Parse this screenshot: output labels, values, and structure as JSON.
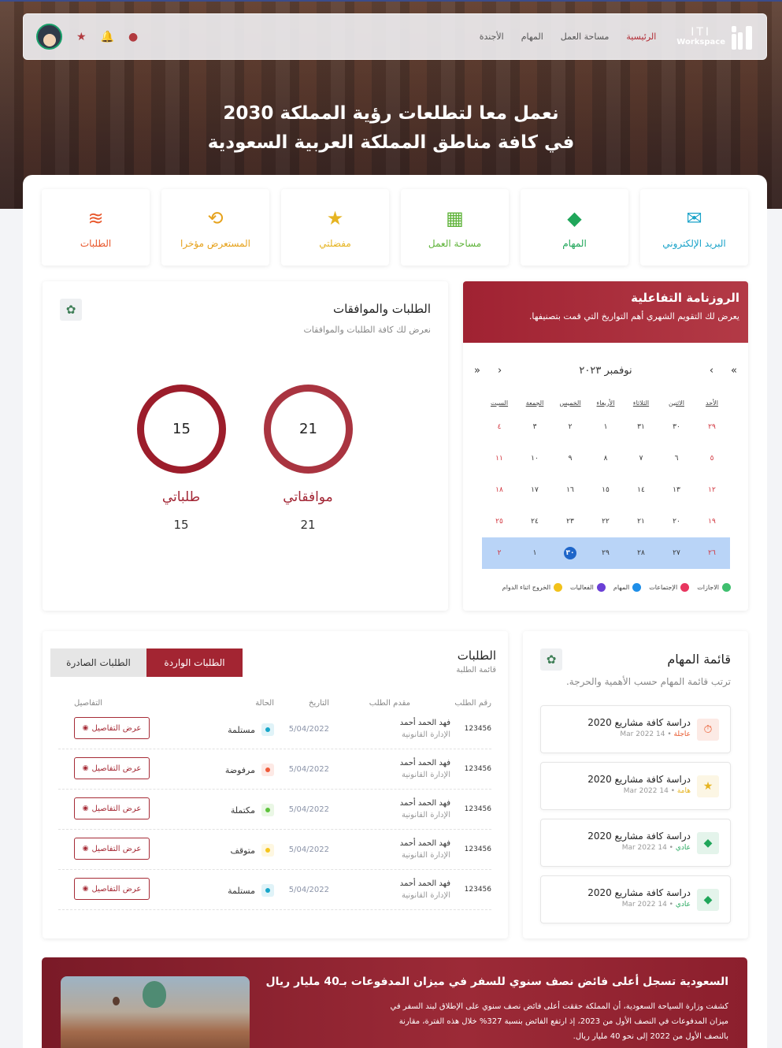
{
  "nav": {
    "brand_top": "ITI",
    "brand_bottom": "Workspace",
    "links": [
      "الرئيسية",
      "مساحة العمل",
      "المهام",
      "الأجندة"
    ]
  },
  "hero": {
    "line1": "نعمل معا لتطلعات رؤية المملكة 2030",
    "line2": "في كافة مناطق المملكة العربية السعودية"
  },
  "quick_links": [
    {
      "label": "البريد الإلكتروني",
      "icon": "mail-icon",
      "color": "#1aa3c9"
    },
    {
      "label": "المهام",
      "icon": "tasks-icon",
      "color": "#20a65a"
    },
    {
      "label": "مساحة العمل",
      "icon": "grid-icon",
      "color": "#5fb33a"
    },
    {
      "label": "مفضلتي",
      "icon": "star-icon",
      "color": "#e6b422"
    },
    {
      "label": "المستعرض مؤخرا",
      "icon": "history-icon",
      "color": "#e6a21c"
    },
    {
      "label": "الطلبات",
      "icon": "layers-icon",
      "color": "#e8562a"
    }
  ],
  "calendar": {
    "title": "الروزنامة التفاعلية",
    "subtitle": "يعرض لك التقويم الشهري أهم التواريخ التي قمت بتصنيفها.",
    "month": "نوفمبر ٢٠٢٣",
    "weekdays": [
      "الأحد",
      "الاثنين",
      "الثلاثاء",
      "الأربعاء",
      "الخميس",
      "الجمعة",
      "السبت"
    ],
    "weeks": [
      [
        "٢٩",
        "٣٠",
        "٣١",
        "١",
        "٢",
        "٣",
        "٤"
      ],
      [
        "٥",
        "٦",
        "٧",
        "٨",
        "٩",
        "١٠",
        "١١"
      ],
      [
        "١٢",
        "١٣",
        "١٤",
        "١٥",
        "١٦",
        "١٧",
        "١٨"
      ],
      [
        "١٩",
        "٢٠",
        "٢١",
        "٢٢",
        "٢٣",
        "٢٤",
        "٢٥"
      ],
      [
        "٢٦",
        "٢٧",
        "٢٨",
        "٢٩",
        "٣٠",
        "١",
        "٢"
      ]
    ],
    "today": "٣٠",
    "legend": [
      {
        "label": "الاجازات",
        "color": "#3fbf6f"
      },
      {
        "label": "الإجتماعات",
        "color": "#e8365f"
      },
      {
        "label": "المهام",
        "color": "#1e8ee8"
      },
      {
        "label": "الفعاليات",
        "color": "#6a3fd6"
      },
      {
        "label": "الخروج اثناء الدوام",
        "color": "#f2c21b"
      }
    ]
  },
  "approvals": {
    "title": "الطلبات والموافقات",
    "subtitle": "نعرض لك كافة الطلبات والموافقات",
    "approvals_value": "21",
    "approvals_label": "موافقاتي",
    "requests_value": "15",
    "requests_label": "طلباتي"
  },
  "requests": {
    "title": "الطلبات",
    "subtitle": "قائمة الطلبة",
    "tab_incoming": "الطلبات الواردة",
    "tab_outgoing": "الطلبات الصادرة",
    "columns": [
      "رقم الطلب",
      "مقدم الطلب",
      "التاريخ",
      "الحالة",
      "التفاصيل"
    ],
    "rows": [
      {
        "id": "123456",
        "name": "فهد الحمد أحمد",
        "dept": "الإدارة القانونية",
        "date": "5/04/2022",
        "status": "مستلمة",
        "status_color": "#17a6c9",
        "btn": "عرض التفاصيل"
      },
      {
        "id": "123456",
        "name": "فهد الحمد أحمد",
        "dept": "الإدارة القانونية",
        "date": "5/04/2022",
        "status": "مرفوضة",
        "status_color": "#ef5a3a",
        "btn": "عرض التفاصيل"
      },
      {
        "id": "123456",
        "name": "فهد الحمد أحمد",
        "dept": "الإدارة القانونية",
        "date": "5/04/2022",
        "status": "مكتملة",
        "status_color": "#5ec23c",
        "btn": "عرض التفاصيل"
      },
      {
        "id": "123456",
        "name": "فهد الحمد أحمد",
        "dept": "الإدارة القانونية",
        "date": "5/04/2022",
        "status": "متوقف",
        "status_color": "#f5c51d",
        "btn": "عرض التفاصيل"
      },
      {
        "id": "123456",
        "name": "فهد الحمد أحمد",
        "dept": "الإدارة القانونية",
        "date": "5/04/2022",
        "status": "مستلمة",
        "status_color": "#17a6c9",
        "btn": "عرض التفاصيل"
      }
    ]
  },
  "tasks": {
    "title": "قائمة المهام",
    "subtitle": "ترتب قائمة المهام حسب الأهمية والحرجة.",
    "items": [
      {
        "title": "دراسة كافة مشاريع 2020",
        "date": "14 Mar 2022",
        "priority": "عاجلة",
        "priority_color": "#e8562a",
        "icon": "timer-icon"
      },
      {
        "title": "دراسة كافة مشاريع 2020",
        "date": "14 Mar 2022",
        "priority": "هامة",
        "priority_color": "#e6b422",
        "icon": "star-icon"
      },
      {
        "title": "دراسة كافة مشاريع 2020",
        "date": "14 Mar 2022",
        "priority": "عادي",
        "priority_color": "#20a65a",
        "icon": "tasks-icon"
      },
      {
        "title": "دراسة كافة مشاريع 2020",
        "date": "14 Mar 2022",
        "priority": "عادي",
        "priority_color": "#20a65a",
        "icon": "tasks-icon"
      }
    ]
  },
  "news": {
    "title": "السعودية تسجل أعلى فائض نصف سنوي للسفر في ميزان المدفوعات بـ40 مليار ريال",
    "body": "كشفت وزارة السياحة السعودية، أن المملكة حققت أعلى فائض نصف سنوي على الإطلاق لبند السفر في ميزان المدفوعات في النصف الأول من 2023، إذ ارتفع الفائض بنسبة 327% خلال هذه الفترة، مقارنة بالنصف الأول من 2022 إلى نحو 40 مليار ريال."
  }
}
